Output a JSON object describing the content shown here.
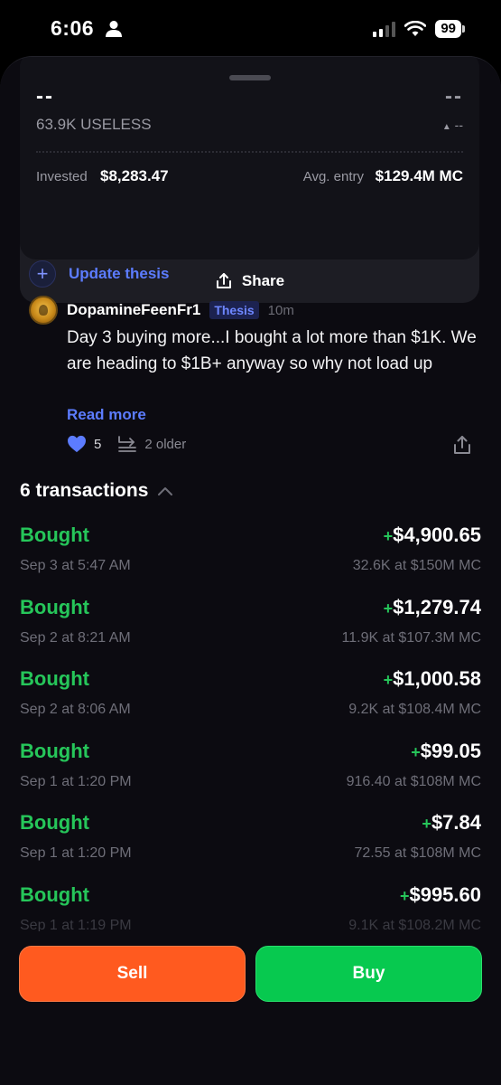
{
  "status_bar": {
    "time": "6:06",
    "battery": "99"
  },
  "position": {
    "primary_value": "--",
    "change_value": "--",
    "holding": "63.9K USELESS",
    "change_pct": "--",
    "invested_label": "Invested",
    "invested_value": "$8,283.47",
    "avg_entry_label": "Avg. entry",
    "avg_entry_value": "$129.4M MC",
    "share_label": "Share"
  },
  "thesis": {
    "update_label": "Update thesis",
    "author": "DopamineFeenFr1",
    "badge": "Thesis",
    "time": "10m",
    "body": "Day 3 buying more...I bought a lot more than $1K. We are heading to $1B+ anyway so why not load up",
    "read_more": "Read more",
    "likes": "5",
    "older": "2 older"
  },
  "transactions": {
    "title": "6 transactions",
    "items": [
      {
        "type": "Bought",
        "amount": "$4,900.65",
        "date": "Sep 3 at 5:47 AM",
        "detail": "32.6K at $150M MC"
      },
      {
        "type": "Bought",
        "amount": "$1,279.74",
        "date": "Sep 2 at 8:21 AM",
        "detail": "11.9K at $107.3M MC"
      },
      {
        "type": "Bought",
        "amount": "$1,000.58",
        "date": "Sep 2 at 8:06 AM",
        "detail": "9.2K at $108.4M MC"
      },
      {
        "type": "Bought",
        "amount": "$99.05",
        "date": "Sep 1 at 1:20 PM",
        "detail": "916.40 at $108M MC"
      },
      {
        "type": "Bought",
        "amount": "$7.84",
        "date": "Sep 1 at 1:20 PM",
        "detail": "72.55 at $108M MC"
      },
      {
        "type": "Bought",
        "amount": "$995.60",
        "date": "Sep 1 at 1:19 PM",
        "detail": "9.1K at $108.2M MC"
      }
    ]
  },
  "actions": {
    "sell_label": "Sell",
    "buy_label": "Buy"
  },
  "colors": {
    "sell": "#ff5a1f",
    "buy": "#07c94f",
    "bought": "#26c65a",
    "accent": "#5c7cff"
  }
}
